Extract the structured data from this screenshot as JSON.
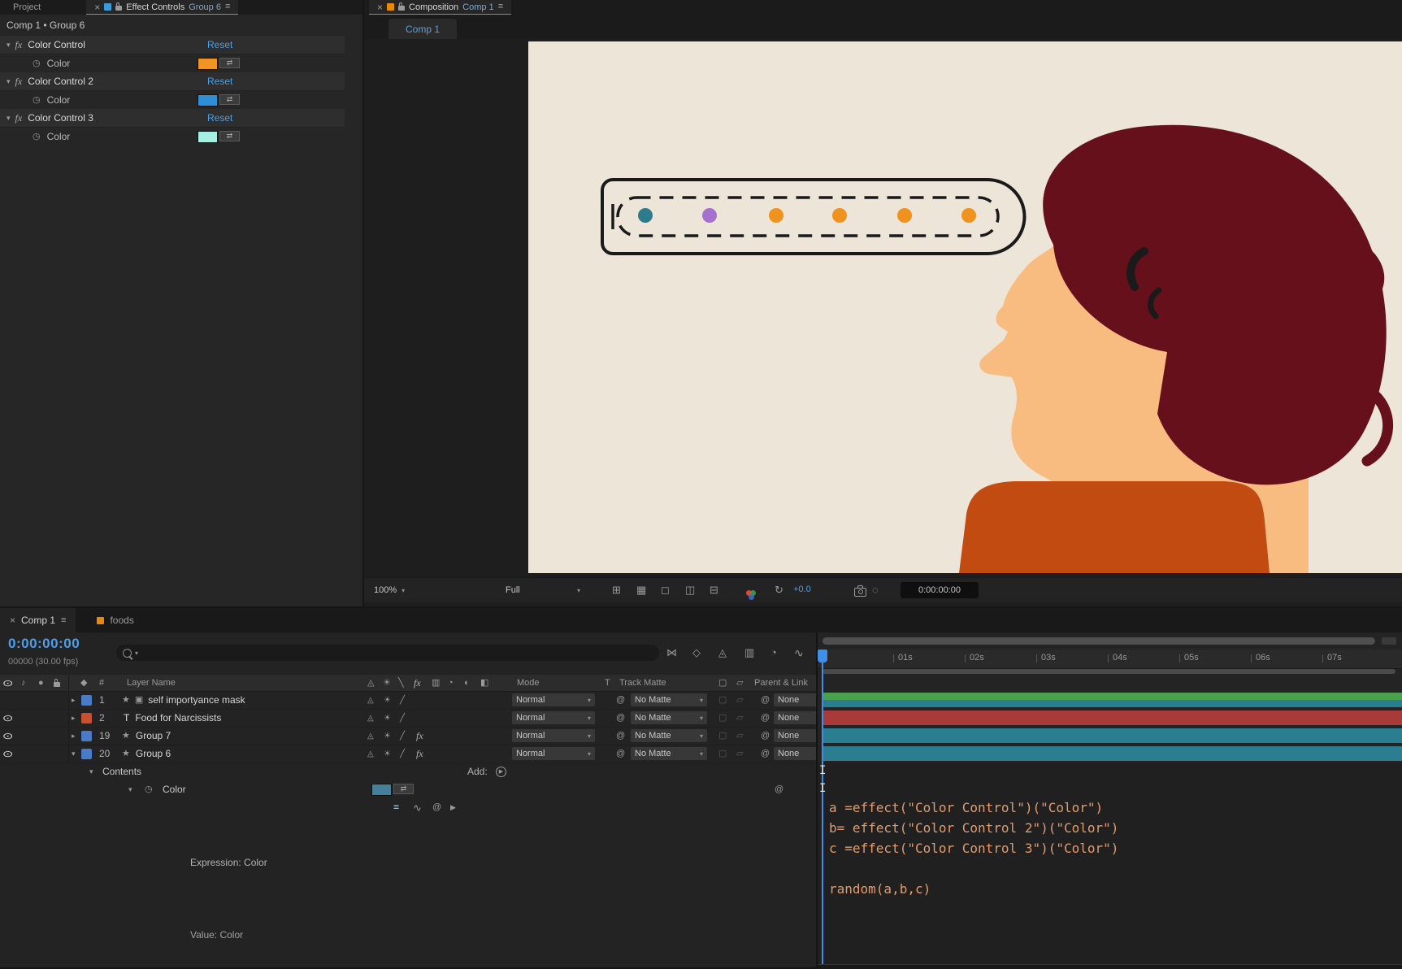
{
  "icons": {
    "close": "×",
    "menu": "≡",
    "twirl_down": "▾",
    "twirl_right": "▸",
    "stopwatch": "◷",
    "fx": "fx",
    "eye": "⊙",
    "audio": "♪",
    "solo": "●",
    "label_tag": "◆",
    "star": "★",
    "mask": "▣",
    "text_layer": "T",
    "shy": "◬",
    "collapse": "☀",
    "quality_row": "╱",
    "quality_col": "╲",
    "frame_blend": "▥",
    "motion_blur": "◔",
    "adjustment": "◐",
    "cube": "◧",
    "dropdown_caret": "▾",
    "pickwhip": "@",
    "frame_box": "▢",
    "skew_box": "▱",
    "graph": "∿",
    "play": "▶",
    "equals": "=",
    "swap": "⇄",
    "mini_flowchart": "⋈",
    "draft_3d": "◇",
    "grid_options": "⊞",
    "transparency_grid": "▦",
    "mask_visibility": "◻",
    "roi": "◫",
    "guides": "⊟",
    "snapshot_show": "◌",
    "exposure_reset": "↻",
    "i_beam": "I"
  },
  "effect_controls": {
    "tab_inactive": "Project",
    "tab_active": "Effect Controls",
    "tab_active_context": "Group 6",
    "breadcrumb": "Comp 1 • Group 6",
    "property_label": "Color",
    "reset_label": "Reset",
    "effects": [
      {
        "name": "Color Control",
        "swatch": "#F09524"
      },
      {
        "name": "Color Control 2",
        "swatch": "#2E8FD8"
      },
      {
        "name": "Color Control 3",
        "swatch": "#A5EFE3"
      }
    ]
  },
  "composition": {
    "tab_panel": "Composition",
    "tab_comp": "Comp 1",
    "viewer_tab": "Comp 1",
    "toolbar": {
      "zoom": "100%",
      "resolution": "Full",
      "exposure": "+0.0",
      "timecode": "0:00:00:00"
    },
    "canvas": {
      "background": "#ECE5D8",
      "outline": "#1A1A1A",
      "dots": [
        "#2E7B8D",
        "#A571CF",
        "#EF931E",
        "#EF931E",
        "#EF931E",
        "#EF931E"
      ],
      "colors": {
        "hair": "#65101A",
        "skin": "#F9BC80",
        "shirt": "#C14B10"
      }
    }
  },
  "timeline": {
    "tab_active": "Comp 1",
    "tab_foods": "foods",
    "foods_chip": "#E8890C",
    "timecode": "0:00:00:00",
    "frame_info": "00000 (30.00 fps)",
    "columns": {
      "num": "#",
      "layer_name": "Layer Name",
      "mode": "Mode",
      "t": "T",
      "track_matte": "Track Matte",
      "parent": "Parent & Link"
    },
    "layers": [
      {
        "num": "1",
        "name": "self importyance mask",
        "mode": "Normal",
        "matte": "No Matte",
        "parent": "None"
      },
      {
        "num": "2",
        "name": "Food for Narcissists",
        "mode": "Normal",
        "matte": "No Matte",
        "parent": "None"
      },
      {
        "num": "19",
        "name": "Group 7",
        "mode": "Normal",
        "matte": "No Matte",
        "parent": "None"
      },
      {
        "num": "20",
        "name": "Group 6",
        "mode": "Normal",
        "matte": "No Matte",
        "parent": "None"
      }
    ],
    "label_colors": [
      "#4A7BC8",
      "#C8502F",
      "#4A7BC8",
      "#4A7BC8"
    ],
    "contents_label": "Contents",
    "add_label": "Add:",
    "color_property": "Color",
    "color_swatch": "#45809B",
    "expression_label": "Expression: Color",
    "value_label": "Value: Color",
    "ruler_ticks": [
      "01s",
      "02s",
      "03s",
      "04s",
      "05s",
      "06s",
      "07s"
    ],
    "expression_lines": [
      "a =effect(\"Color Control\")(\"Color\")",
      "b= effect(\"Color Control 2\")(\"Color\")",
      "c =effect(\"Color Control 3\")(\"Color\")",
      "random(a,b,c)"
    ],
    "bar_colors": {
      "layer1_top": "#49A04D",
      "layer1_bottom": "#2B7E90",
      "layer2": "#A83A3A",
      "layer19": "#2B7E90",
      "layer20": "#2B7E90"
    }
  }
}
